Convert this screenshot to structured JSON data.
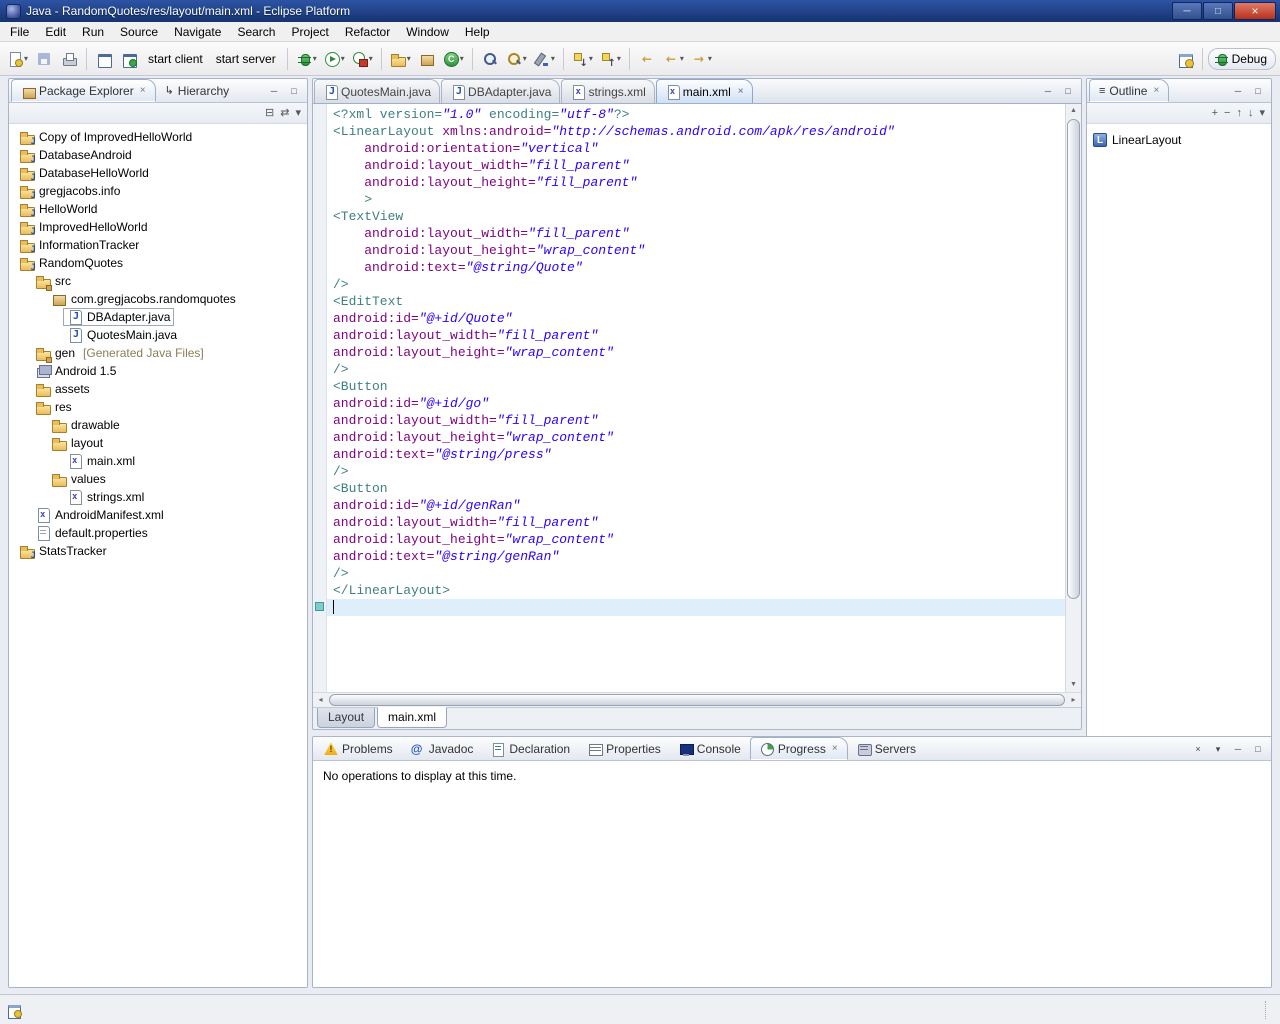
{
  "window": {
    "title": "Java - RandomQuotes/res/layout/main.xml - Eclipse Platform"
  },
  "glyphs": {
    "close": "×",
    "minimize": "─",
    "maximize": "□",
    "dropdown": "▾",
    "collapse_all": "⊟",
    "link_editor": "⇄",
    "menu": "▾",
    "up": "↑",
    "down": "↓",
    "back": "←",
    "forward": "→",
    "scroll_up": "▲",
    "scroll_down": "▼",
    "scroll_left": "◂",
    "scroll_right": "▸",
    "hierarchy": "↳",
    "plus": "+",
    "minus": "−",
    "clear": "×"
  },
  "menu": {
    "items": [
      "File",
      "Edit",
      "Run",
      "Source",
      "Navigate",
      "Search",
      "Project",
      "Refactor",
      "Window",
      "Help"
    ]
  },
  "toolbar": {
    "start_client": "start client",
    "start_server": "start server",
    "perspective_label": "Debug"
  },
  "package_explorer": {
    "title": "Package Explorer",
    "hierarchy_tab": "Hierarchy",
    "tree": [
      {
        "depth": 0,
        "icon": "project",
        "label": "Copy of ImprovedHelloWorld"
      },
      {
        "depth": 0,
        "icon": "project",
        "label": "DatabaseAndroid"
      },
      {
        "depth": 0,
        "icon": "project",
        "label": "DatabaseHelloWorld"
      },
      {
        "depth": 0,
        "icon": "project",
        "label": "gregjacobs.info"
      },
      {
        "depth": 0,
        "icon": "project",
        "label": "HelloWorld"
      },
      {
        "depth": 0,
        "icon": "project",
        "label": "ImprovedHelloWorld"
      },
      {
        "depth": 0,
        "icon": "project",
        "label": "InformationTracker"
      },
      {
        "depth": 0,
        "icon": "project",
        "label": "RandomQuotes"
      },
      {
        "depth": 1,
        "icon": "srcfolder",
        "label": "src"
      },
      {
        "depth": 2,
        "icon": "package",
        "label": "com.gregjacobs.randomquotes"
      },
      {
        "depth": 3,
        "icon": "javafile",
        "label": "DBAdapter.java",
        "focus": true
      },
      {
        "depth": 3,
        "icon": "javafile",
        "label": "QuotesMain.java"
      },
      {
        "depth": 1,
        "icon": "srcfolder",
        "label": "gen",
        "suffix": "[Generated Java Files]"
      },
      {
        "depth": 1,
        "icon": "library",
        "label": "Android 1.5"
      },
      {
        "depth": 1,
        "icon": "folder",
        "label": "assets"
      },
      {
        "depth": 1,
        "icon": "folder",
        "label": "res"
      },
      {
        "depth": 2,
        "icon": "folder",
        "label": "drawable"
      },
      {
        "depth": 2,
        "icon": "folder",
        "label": "layout"
      },
      {
        "depth": 3,
        "icon": "xmlfile",
        "label": "main.xml"
      },
      {
        "depth": 2,
        "icon": "folder",
        "label": "values"
      },
      {
        "depth": 3,
        "icon": "xmlfile",
        "label": "strings.xml"
      },
      {
        "depth": 1,
        "icon": "xmlfile",
        "label": "AndroidManifest.xml"
      },
      {
        "depth": 1,
        "icon": "propfile",
        "label": "default.properties"
      },
      {
        "depth": 0,
        "icon": "project",
        "label": "StatsTracker"
      }
    ]
  },
  "editor": {
    "tabs": [
      {
        "label": "QuotesMain.java",
        "icon": "javafile",
        "active": false
      },
      {
        "label": "DBAdapter.java",
        "icon": "javafile",
        "active": false
      },
      {
        "label": "strings.xml",
        "icon": "xmlfile",
        "active": false
      },
      {
        "label": "main.xml",
        "icon": "xmlfile",
        "active": true
      }
    ],
    "bottom_tabs": [
      {
        "label": "Layout",
        "active": false
      },
      {
        "label": "main.xml",
        "active": true
      }
    ],
    "cursor_line": 30,
    "code": [
      [
        [
          "t",
          "<?xml version="
        ],
        [
          "v",
          "\"1.0\""
        ],
        [
          "t",
          " encoding="
        ],
        [
          "v",
          "\"utf-8\""
        ],
        [
          "t",
          "?>"
        ]
      ],
      [
        [
          "t",
          "<LinearLayout"
        ],
        [
          "p",
          " "
        ],
        [
          "a",
          "xmlns:android="
        ],
        [
          "v",
          "\"http://schemas.android.com/apk/res/android\""
        ]
      ],
      [
        [
          "p",
          "    "
        ],
        [
          "a",
          "android:orientation="
        ],
        [
          "v",
          "\"vertical\""
        ]
      ],
      [
        [
          "p",
          "    "
        ],
        [
          "a",
          "android:layout_width="
        ],
        [
          "v",
          "\"fill_parent\""
        ]
      ],
      [
        [
          "p",
          "    "
        ],
        [
          "a",
          "android:layout_height="
        ],
        [
          "v",
          "\"fill_parent\""
        ]
      ],
      [
        [
          "p",
          "    "
        ],
        [
          "t",
          ">"
        ]
      ],
      [
        [
          "t",
          "<TextView"
        ]
      ],
      [
        [
          "p",
          "    "
        ],
        [
          "a",
          "android:layout_width="
        ],
        [
          "v",
          "\"fill_parent\""
        ]
      ],
      [
        [
          "p",
          "    "
        ],
        [
          "a",
          "android:layout_height="
        ],
        [
          "v",
          "\"wrap_content\""
        ]
      ],
      [
        [
          "p",
          "    "
        ],
        [
          "a",
          "android:text="
        ],
        [
          "v",
          "\"@string/Quote\""
        ]
      ],
      [
        [
          "t",
          "/>"
        ]
      ],
      [
        [
          "t",
          "<EditText"
        ]
      ],
      [
        [
          "a",
          "android:id="
        ],
        [
          "v",
          "\"@+id/Quote\""
        ]
      ],
      [
        [
          "a",
          "android:layout_width="
        ],
        [
          "v",
          "\"fill_parent\""
        ]
      ],
      [
        [
          "a",
          "android:layout_height="
        ],
        [
          "v",
          "\"wrap_content\""
        ]
      ],
      [
        [
          "t",
          "/>"
        ]
      ],
      [
        [
          "t",
          "<Button"
        ]
      ],
      [
        [
          "a",
          "android:id="
        ],
        [
          "v",
          "\"@+id/go\""
        ]
      ],
      [
        [
          "a",
          "android:layout_width="
        ],
        [
          "v",
          "\"fill_parent\""
        ]
      ],
      [
        [
          "a",
          "android:layout_height="
        ],
        [
          "v",
          "\"wrap_content\""
        ]
      ],
      [
        [
          "a",
          "android:text="
        ],
        [
          "v",
          "\"@string/press\""
        ]
      ],
      [
        [
          "t",
          "/>"
        ]
      ],
      [
        [
          "t",
          "<Button"
        ]
      ],
      [
        [
          "a",
          "android:id="
        ],
        [
          "v",
          "\"@+id/genRan\""
        ]
      ],
      [
        [
          "a",
          "android:layout_width="
        ],
        [
          "v",
          "\"fill_parent\""
        ]
      ],
      [
        [
          "a",
          "android:layout_height="
        ],
        [
          "v",
          "\"wrap_content\""
        ]
      ],
      [
        [
          "a",
          "android:text="
        ],
        [
          "v",
          "\"@string/genRan\""
        ]
      ],
      [
        [
          "t",
          "/>"
        ]
      ],
      [
        [
          "t",
          "</LinearLayout>"
        ]
      ],
      []
    ]
  },
  "outline": {
    "title": "Outline",
    "items": [
      {
        "icon": "linearlayout",
        "letter": "L",
        "label": "LinearLayout"
      }
    ]
  },
  "bottom_panel": {
    "tabs": [
      {
        "label": "Problems",
        "icon": "problems",
        "active": false
      },
      {
        "label": "Javadoc",
        "icon": "javadoc",
        "active": false
      },
      {
        "label": "Declaration",
        "icon": "declaration",
        "active": false
      },
      {
        "label": "Properties",
        "icon": "properties",
        "active": false
      },
      {
        "label": "Console",
        "icon": "console",
        "active": false
      },
      {
        "label": "Progress",
        "icon": "progress",
        "active": true
      },
      {
        "label": "Servers",
        "icon": "servers",
        "active": false
      }
    ],
    "message": "No operations to display at this time."
  },
  "colors": {
    "titlebar": "#17336f",
    "current_line": "#dfeefb",
    "xml_tag": "#3f7f7f",
    "xml_attr": "#7f007f",
    "xml_value": "#2a00ff"
  }
}
